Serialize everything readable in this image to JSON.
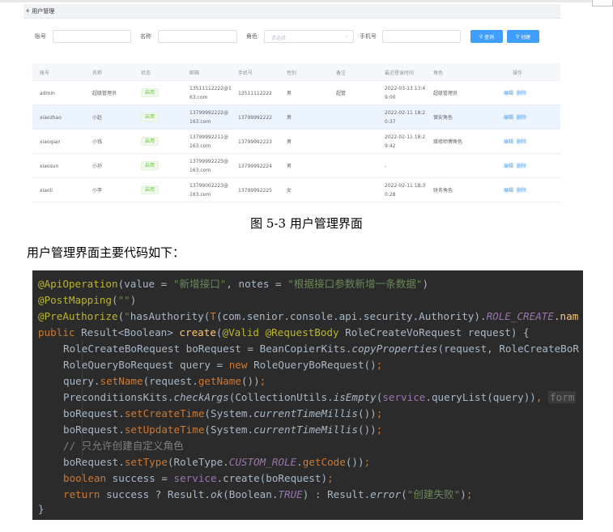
{
  "screenshot": {
    "header_title": "用户管理",
    "search": {
      "account_label": "账号",
      "name_label": "名称",
      "role_label": "角色",
      "role_placeholder": "请选择",
      "phone_label": "手机号",
      "query_button": "查询",
      "create_button": "创建"
    },
    "table": {
      "columns": [
        "账号",
        "名称",
        "状态",
        "邮箱",
        "手机号",
        "性别",
        "备注",
        "最近登录时间",
        "角色",
        "操作"
      ],
      "rows": [
        {
          "account": "admin",
          "name": "超级管理员",
          "status": "启用",
          "email_1": "13511112222@1",
          "email_2": "63.com",
          "phone": "13511112222",
          "gender": "男",
          "remark": "超管",
          "login_1": "2022-03-13 13:4",
          "login_2": "9:00",
          "role": "超级管理员",
          "edit": "编辑",
          "delete": "删除"
        },
        {
          "account": "xiaozhao",
          "name": "小赵",
          "status": "启用",
          "email_1": "13799992222@",
          "email_2": "163.com",
          "phone": "13799992222",
          "gender": "男",
          "remark": "",
          "login_1": "2022-02-11 18:2",
          "login_2": "0:37",
          "role": "保安角色",
          "edit": "编辑",
          "delete": "删除"
        },
        {
          "account": "xiaoqian",
          "name": "小钱",
          "status": "启用",
          "email_1": "13799992211@",
          "email_2": "163.com",
          "phone": "13799992223",
          "gender": "男",
          "remark": "",
          "login_1": "2022-02-11 18:2",
          "login_2": "9:42",
          "role": "维修师傅角色",
          "edit": "编辑",
          "delete": "删除"
        },
        {
          "account": "xiaosun",
          "name": "小孙",
          "status": "启用",
          "email_1": "13799992223@",
          "email_2": "163.com",
          "phone": "13799992224",
          "gender": "男",
          "remark": "",
          "login_1": "-",
          "login_2": "",
          "role": "",
          "edit": "编辑",
          "delete": "删除"
        },
        {
          "account": "xiaoli",
          "name": "小李",
          "status": "启用",
          "email_1": "13799002223@",
          "email_2": "163.com",
          "phone": "13799992225",
          "gender": "女",
          "remark": "",
          "login_1": "2022-02-11 18:3",
          "login_2": "0:28",
          "role": "财务角色",
          "edit": "编辑",
          "delete": "删除"
        }
      ]
    }
  },
  "figure_caption": "图 5-3 用户管理界面",
  "intro_text": "用户管理界面主要代码如下：",
  "code": {
    "l1_ann": "@ApiOperation",
    "l1_a": "(value = ",
    "l1_s1": "\"新增接口\"",
    "l1_b": ", notes = ",
    "l1_s2": "\"根据接口参数新增一条数据\"",
    "l1_c": ")",
    "l2_ann": "@PostMapping",
    "l2_a": "(",
    "l2_s": "\"\"",
    "l2_c": ")",
    "l3_ann": "@PreAuthorize",
    "l3_a": "(",
    "l3_s1": "\"",
    "l3_b": "hasAuthority(",
    "l3_t": "T",
    "l3_c": "(com.senior.console.api.security.Authority).",
    "l3_d": "ROLE_CREATE",
    "l3_e": ".nam",
    "l4_kw1": "public ",
    "l4_a": "Result<Boolean> ",
    "l4_fn": "create",
    "l4_b": "(",
    "l4_ann1": "@Valid ",
    "l4_ann2": "@RequestBody ",
    "l4_c": "RoleCreateVoRequest request) {",
    "l5_a": "RoleCreateBoRequest boRequest = BeanCopierKits.",
    "l5_m": "copyProperties",
    "l5_b": "(request, RoleCreateBoR",
    "l6_a": "RoleQueryBoRequest query = ",
    "l6_kw": "new ",
    "l6_b": "RoleQueryBoRequest()",
    "l6_c": ";",
    "l7_a": "query.",
    "l7_m1": "setName",
    "l7_b": "(request.",
    "l7_m2": "getName",
    "l7_c": "())",
    "l7_d": ";",
    "l8_a": "PreconditionsKits.",
    "l8_m1": "checkArgs",
    "l8_b": "(CollectionUtils.",
    "l8_m2": "isEmpty",
    "l8_c": "(",
    "l8_f": "service",
    "l8_d": ".queryList(query))",
    "l8_e": ", ",
    "l8_hint": "form",
    "l9_a": "boRequest.",
    "l9_m": "setCreateTime",
    "l9_b": "(System.",
    "l9_m2": "currentTimeMillis",
    "l9_c": "())",
    "l9_d": ";",
    "l10_a": "boRequest.",
    "l10_m": "setUpdateTime",
    "l10_b": "(System.",
    "l10_m2": "currentTimeMillis",
    "l10_c": "())",
    "l10_d": ";",
    "l11_cmt": "// 只允许创建自定义角色",
    "l12_a": "boRequest.",
    "l12_m": "setType",
    "l12_b": "(RoleType.",
    "l12_f": "CUSTOM_ROLE",
    "l12_c": ".",
    "l12_m2": "getCode",
    "l12_d": "())",
    "l12_e": ";",
    "l13_kw": "boolean ",
    "l13_a": "success = ",
    "l13_f": "service",
    "l13_b": ".create(boRequest)",
    "l13_c": ";",
    "l14_kw": "return ",
    "l14_a": "success ? Result.",
    "l14_m1": "ok",
    "l14_b": "(Boolean.",
    "l14_f": "TRUE",
    "l14_c": ") : Result.",
    "l14_m2": "error",
    "l14_d": "(",
    "l14_s": "\"创建失败\"",
    "l14_e": ")",
    "l14_f2": ";",
    "l15": "}"
  }
}
